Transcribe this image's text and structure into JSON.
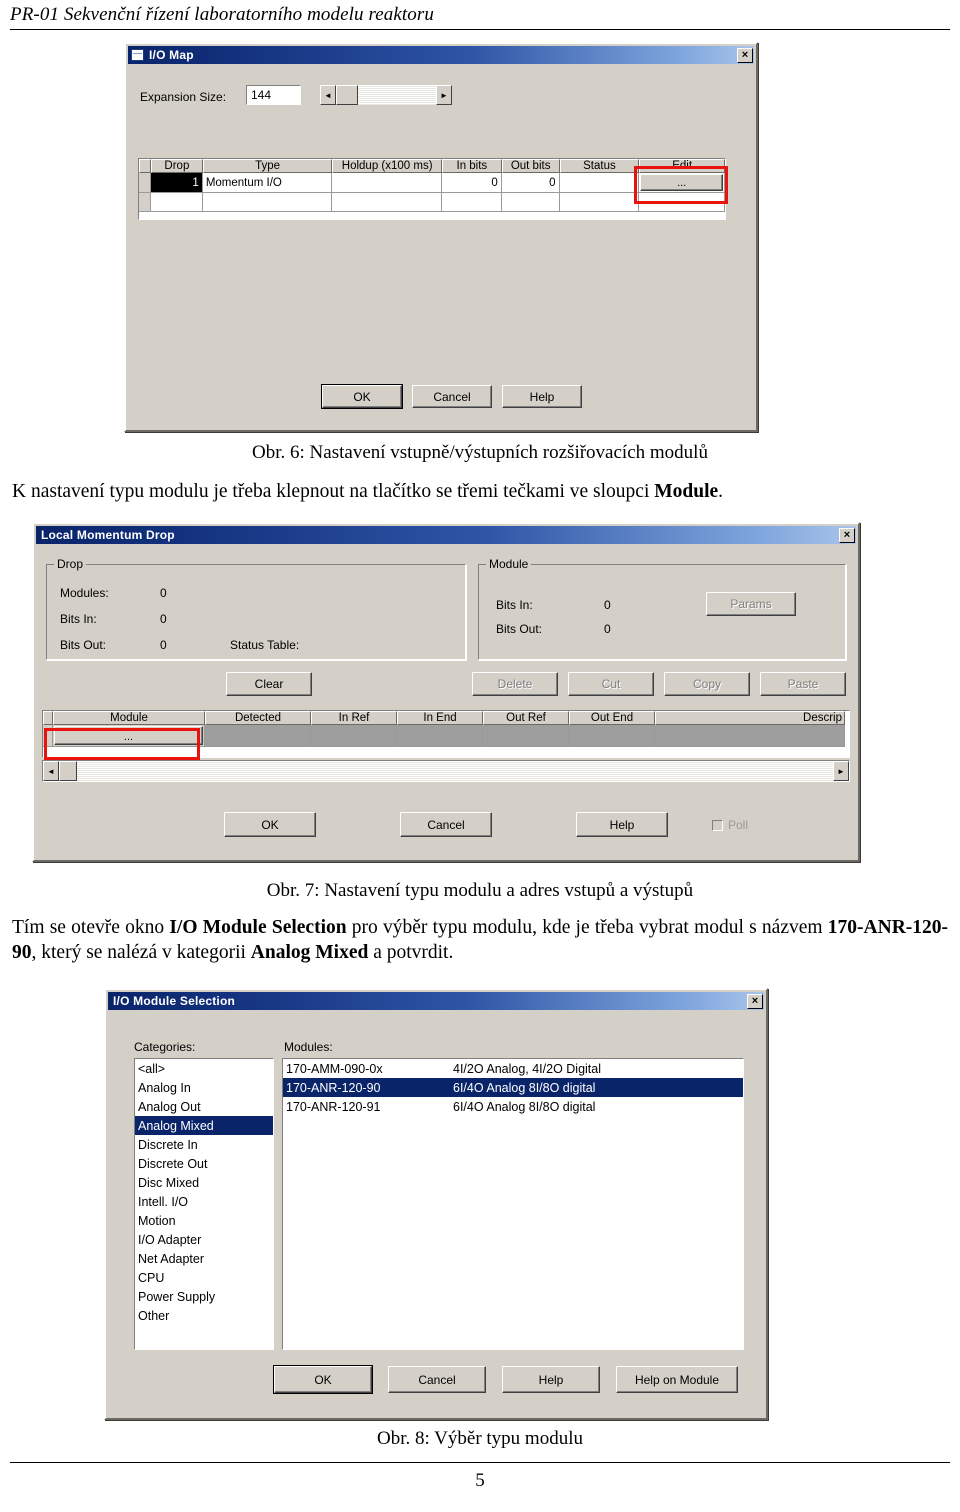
{
  "page": {
    "running_head": "PR-01 Sekvenční řízení laboratorního modelu reaktoru",
    "number": "5"
  },
  "figure6": {
    "caption": "Obr. 6: Nastavení vstupně/výstupních rozšiřovacích modulů",
    "dialog": {
      "title": "I/O Map",
      "close_label": "×",
      "expansion_size_label": "Expansion Size:",
      "expansion_size_value": "144",
      "scroll_left_glyph": "◄",
      "scroll_right_glyph": "►",
      "columns": [
        "Drop",
        "Type",
        "Holdup (x100 ms)",
        "In bits",
        "Out bits",
        "Status",
        "Edit"
      ],
      "rows": [
        {
          "drop": "1",
          "type": "Momentum I/O",
          "holdup": "",
          "in_bits": "0",
          "out_bits": "0",
          "status": "",
          "edit": "..."
        },
        {
          "drop": "",
          "type": "",
          "holdup": "",
          "in_bits": "",
          "out_bits": "",
          "status": "",
          "edit": ""
        }
      ],
      "buttons": {
        "ok": "OK",
        "cancel": "Cancel",
        "help": "Help"
      }
    }
  },
  "text_after_fig6": {
    "line1_a": "K nastavení typu modulu je třeba klepnout na tlačítko se třemi tečkami ve sloupci ",
    "line1_b": "Module",
    "line1_c": "."
  },
  "figure7": {
    "caption": "Obr. 7: Nastavení typu modulu a adres vstupů a výstupů",
    "dialog": {
      "title": "Local Momentum Drop",
      "close_label": "×",
      "drop_group": {
        "legend": "Drop",
        "modules_label": "Modules:",
        "modules_value": "0",
        "bits_in_label": "Bits In:",
        "bits_in_value": "0",
        "bits_out_label": "Bits Out:",
        "bits_out_value": "0",
        "status_table_label": "Status Table:"
      },
      "module_group": {
        "legend": "Module",
        "bits_in_label": "Bits In:",
        "bits_in_value": "0",
        "bits_out_label": "Bits Out:",
        "bits_out_value": "0",
        "params_button": "Params"
      },
      "edit_buttons": {
        "clear": "Clear",
        "delete": "Delete",
        "cut": "Cut",
        "copy": "Copy",
        "paste": "Paste"
      },
      "columns": [
        "Module",
        "Detected",
        "In Ref",
        "In End",
        "Out Ref",
        "Out End",
        "Descrip"
      ],
      "rows": [
        {
          "module": "...",
          "detected": "",
          "in_ref": "",
          "in_end": "",
          "out_ref": "",
          "out_end": "",
          "descrip": ""
        }
      ],
      "scroll_left_glyph": "◄",
      "scroll_right_glyph": "►",
      "buttons": {
        "ok": "OK",
        "cancel": "Cancel",
        "help": "Help"
      },
      "poll_label": "Poll"
    }
  },
  "text_after_fig7": {
    "seg1": "Tím se otevře okno ",
    "seg2": "I/O Module Selection",
    "seg3": " pro výběr typu modulu, kde je třeba vybrat modul s názvem ",
    "seg4": "170-ANR-120-90",
    "seg5": ", který se nalézá v kategorii ",
    "seg6": "Analog Mixed",
    "seg7": " a potvrdit."
  },
  "figure8": {
    "caption": "Obr. 8: Výběr typu modulu",
    "dialog": {
      "title": "I/O Module Selection",
      "close_label": "×",
      "categories_label": "Categories:",
      "modules_label": "Modules:",
      "categories": [
        {
          "label": "<all>",
          "selected": false
        },
        {
          "label": "Analog In",
          "selected": false
        },
        {
          "label": "Analog Out",
          "selected": false
        },
        {
          "label": "Analog Mixed",
          "selected": true
        },
        {
          "label": "Discrete In",
          "selected": false
        },
        {
          "label": "Discrete Out",
          "selected": false
        },
        {
          "label": "Disc Mixed",
          "selected": false
        },
        {
          "label": "Intell. I/O",
          "selected": false
        },
        {
          "label": "Motion",
          "selected": false
        },
        {
          "label": "I/O Adapter",
          "selected": false
        },
        {
          "label": "Net Adapter",
          "selected": false
        },
        {
          "label": "CPU",
          "selected": false
        },
        {
          "label": "Power Supply",
          "selected": false
        },
        {
          "label": "Other",
          "selected": false
        }
      ],
      "modules": [
        {
          "name": "170-AMM-090-0x",
          "desc": "4I/2O Analog, 4I/2O Digital",
          "selected": false
        },
        {
          "name": "170-ANR-120-90",
          "desc": "6I/4O Analog 8I/8O digital",
          "selected": true
        },
        {
          "name": "170-ANR-120-91",
          "desc": "6I/4O Analog 8I/8O digital",
          "selected": false
        }
      ],
      "buttons": {
        "ok": "OK",
        "cancel": "Cancel",
        "help": "Help",
        "help_on_module": "Help on Module"
      }
    }
  },
  "colors": {
    "title_bar_start": "#0a246a",
    "title_bar_end": "#a8c4ea",
    "dialog_face": "#d4d0c8",
    "selection": "#0a246a",
    "annotation": "#e8120e"
  }
}
